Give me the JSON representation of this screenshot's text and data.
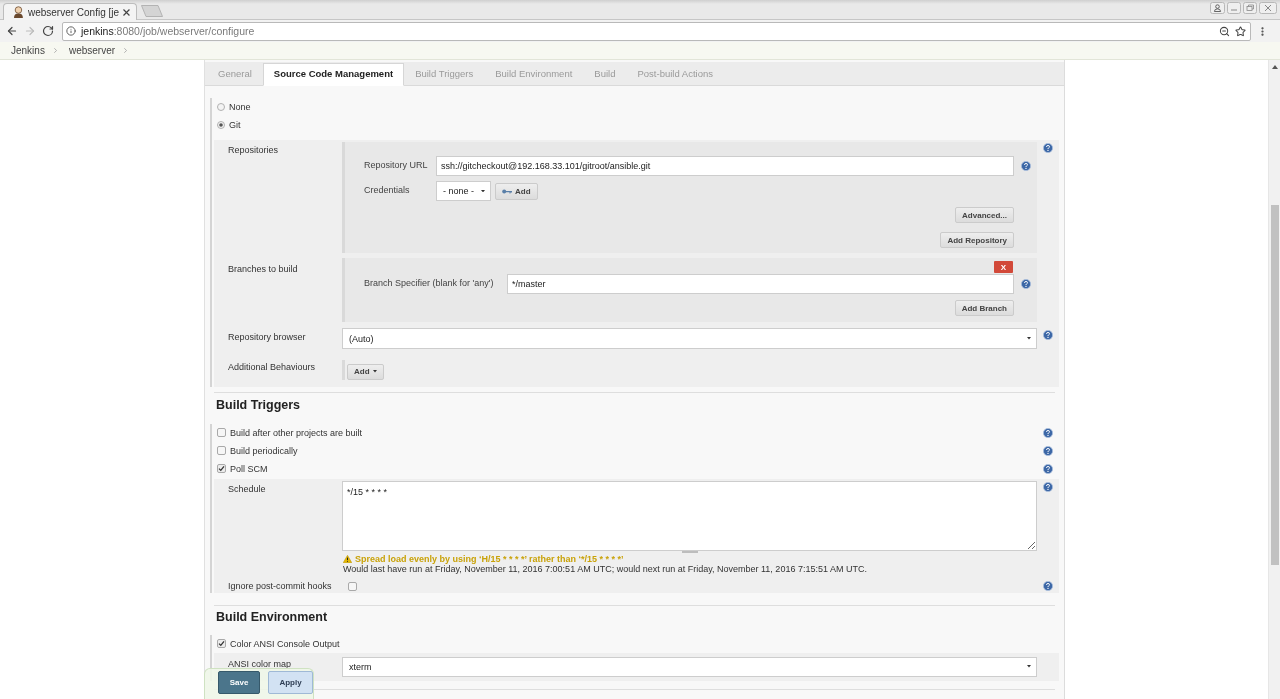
{
  "browser": {
    "tab_title": "webserver Config [je",
    "url": {
      "host": "jenkins",
      "path": ":8080/job/webserver/configure"
    }
  },
  "breadcrumbs": [
    {
      "label": "Jenkins"
    },
    {
      "label": "webserver"
    }
  ],
  "tabs": [
    {
      "label": "General",
      "selected": false
    },
    {
      "label": "Source Code Management",
      "selected": true
    },
    {
      "label": "Build Triggers",
      "selected": false
    },
    {
      "label": "Build Environment",
      "selected": false
    },
    {
      "label": "Build",
      "selected": false
    },
    {
      "label": "Post-build Actions",
      "selected": false
    }
  ],
  "scm": {
    "options": [
      {
        "label": "None",
        "selected": false
      },
      {
        "label": "Git",
        "selected": true
      }
    ],
    "repositories": {
      "label": "Repositories",
      "url_label": "Repository URL",
      "url": "ssh://gitcheckout@192.168.33.101/gitroot/ansible.git",
      "credentials_label": "Credentials",
      "credentials": "- none -",
      "add_button": "Add",
      "advanced_button": "Advanced...",
      "add_repository_button": "Add Repository"
    },
    "branches": {
      "label": "Branches to build",
      "delete_button": "X",
      "specifier_label": "Branch Specifier (blank for 'any')",
      "specifier": "*/master",
      "add_branch_button": "Add Branch"
    },
    "repository_browser": {
      "label": "Repository browser",
      "value": "(Auto)"
    },
    "additional_behaviours": {
      "label": "Additional Behaviours",
      "button": "Add"
    }
  },
  "build_triggers": {
    "title": "Build Triggers",
    "options": [
      {
        "label": "Build after other projects are built",
        "checked": false
      },
      {
        "label": "Build periodically",
        "checked": false
      },
      {
        "label": "Poll SCM",
        "checked": true
      }
    ],
    "schedule": {
      "label": "Schedule",
      "value": "*/15 * * * *",
      "warning": "Spread load evenly by using ‘H/15 * * * *’ rather than ‘*/15 * * * *’",
      "info": "Would last have run at Friday, November 11, 2016 7:00:51 AM UTC; would next run at Friday, November 11, 2016 7:15:51 AM UTC."
    },
    "ignore_hooks": {
      "label": "Ignore post-commit hooks",
      "checked": false
    }
  },
  "build_environment": {
    "title": "Build Environment",
    "options": [
      {
        "label": "Color ANSI Console Output",
        "checked": true
      }
    ],
    "color_map": {
      "label": "ANSI color map",
      "value": "xterm"
    }
  },
  "actions": [
    {
      "label": "Save",
      "kind": "primary"
    },
    {
      "label": "Apply",
      "kind": "secondary"
    }
  ]
}
